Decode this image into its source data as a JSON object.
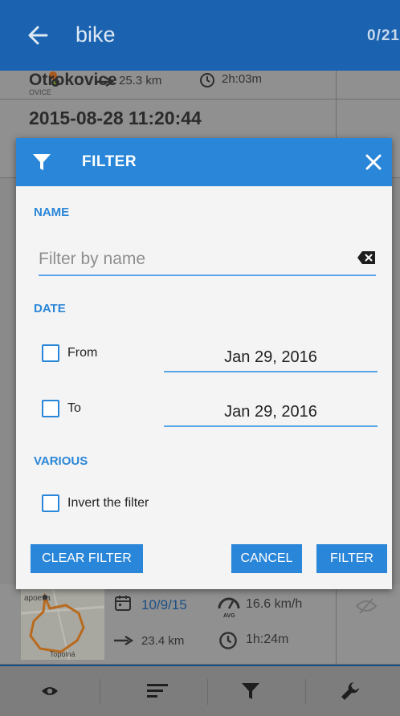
{
  "appbar": {
    "title": "bike",
    "count": "0/21"
  },
  "tracks": [
    {
      "name": "Otrokovice",
      "distance": "25.3 km",
      "duration": "2h:03m",
      "sublabel": "OVICE"
    },
    {
      "title": "2015-08-28 11:20:44"
    },
    {
      "date": "10/9/15",
      "avg_speed": "16.6 km/h",
      "speed_badge": "AVG",
      "distance": "23.4 km",
      "duration": "1h:24m",
      "map_label_1": "apoetla",
      "map_label_2": "Topolná"
    }
  ],
  "dialog": {
    "title": "FILTER",
    "name_section": "NAME",
    "name_placeholder": "Filter by name",
    "date_section": "DATE",
    "from_label": "From",
    "from_date": "Jan 29, 2016",
    "to_label": "To",
    "to_date": "Jan 29, 2016",
    "various_section": "VARIOUS",
    "invert_label": "Invert the filter",
    "clear_button": "CLEAR FILTER",
    "cancel_button": "CANCEL",
    "filter_button": "FILTER"
  },
  "colors": {
    "accent": "#2a86d8",
    "appbar": "#1b63b0",
    "link": "#1d4f86"
  },
  "icons": [
    "back-arrow-icon",
    "filter-icon",
    "close-icon",
    "backspace-icon",
    "calendar-icon",
    "speed-gauge-icon",
    "arrow-right-icon",
    "clock-icon",
    "eye-icon",
    "sort-icon",
    "wrench-icon",
    "visibility-off-icon"
  ]
}
